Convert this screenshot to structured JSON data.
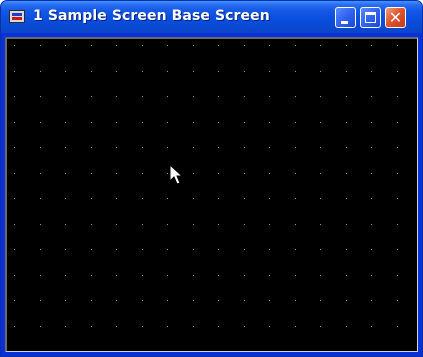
{
  "window": {
    "title": "1 Sample Screen Base Screen",
    "icon": "screen-app-icon"
  },
  "titlebar": {
    "buttons": {
      "minimize": {
        "icon": "minimize-icon"
      },
      "maximize": {
        "icon": "maximize-icon"
      },
      "close": {
        "icon": "close-icon",
        "glyph": "✕"
      }
    }
  },
  "canvas": {
    "background_color": "#000000",
    "grid_dot_color": "#34c4b0",
    "grid": true
  },
  "cursor": {
    "icon": "arrow-cursor-icon"
  }
}
